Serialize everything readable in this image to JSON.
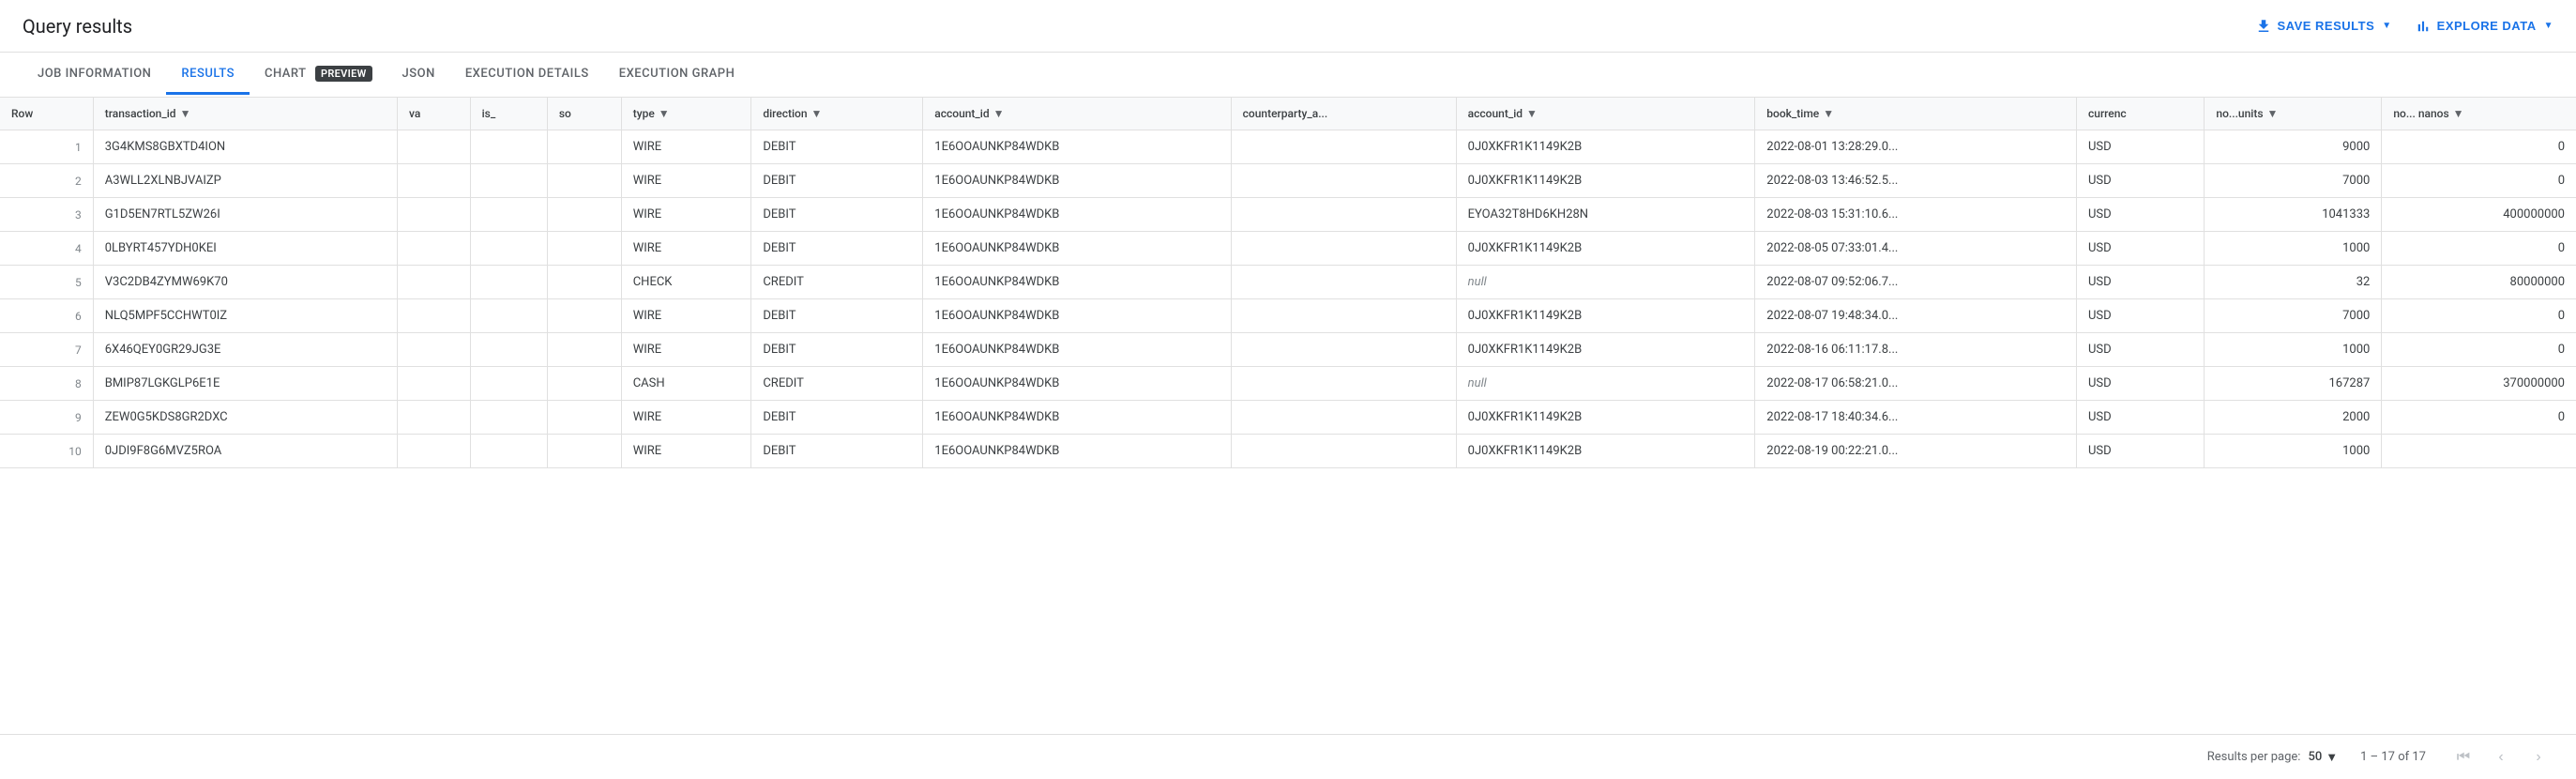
{
  "header": {
    "title": "Query results",
    "actions": {
      "save_results": "SAVE RESULTS",
      "explore_data": "EXPLORE DATA"
    }
  },
  "tabs": [
    {
      "id": "job-info",
      "label": "JOB INFORMATION",
      "active": false
    },
    {
      "id": "results",
      "label": "RESULTS",
      "active": true
    },
    {
      "id": "chart",
      "label": "CHART",
      "active": false,
      "badge": "PREVIEW"
    },
    {
      "id": "json",
      "label": "JSON",
      "active": false
    },
    {
      "id": "execution-details",
      "label": "EXECUTION DETAILS",
      "active": false
    },
    {
      "id": "execution-graph",
      "label": "EXECUTION GRAPH",
      "active": false
    }
  ],
  "table": {
    "columns": [
      {
        "id": "row",
        "label": "Row",
        "sortable": false
      },
      {
        "id": "transaction_id",
        "label": "transaction_id",
        "sortable": true
      },
      {
        "id": "va",
        "label": "va",
        "sortable": false
      },
      {
        "id": "is_",
        "label": "is_",
        "sortable": false
      },
      {
        "id": "so",
        "label": "so",
        "sortable": false
      },
      {
        "id": "type",
        "label": "type",
        "sortable": true
      },
      {
        "id": "direction",
        "label": "direction",
        "sortable": true
      },
      {
        "id": "account_id",
        "label": "account_id",
        "sortable": true
      },
      {
        "id": "counterparty_a",
        "label": "counterparty_a...",
        "sortable": false
      },
      {
        "id": "account_id2",
        "label": "account_id",
        "sortable": true
      },
      {
        "id": "book_time",
        "label": "book_time",
        "sortable": true
      },
      {
        "id": "currency",
        "label": "currenc",
        "sortable": false
      },
      {
        "id": "no_units",
        "label": "no...units",
        "sortable": true
      },
      {
        "id": "no_nanos",
        "label": "no... nanos",
        "sortable": true
      }
    ],
    "rows": [
      {
        "row": 1,
        "transaction_id": "3G4KMS8GBXTD4ION",
        "va": "",
        "is_": "",
        "so": "",
        "type": "WIRE",
        "direction": "DEBIT",
        "account_id": "1E6OOAUNKP84WDKB",
        "counterparty_a": "",
        "account_id2": "0J0XKFR1K1149K2B",
        "book_time": "2022-08-01 13:28:29.0...",
        "currency": "USD",
        "no_units": "9000",
        "no_nanos": "0"
      },
      {
        "row": 2,
        "transaction_id": "A3WLL2XLNBJVAIZP",
        "va": "",
        "is_": "",
        "so": "",
        "type": "WIRE",
        "direction": "DEBIT",
        "account_id": "1E6OOAUNKP84WDKB",
        "counterparty_a": "",
        "account_id2": "0J0XKFR1K1149K2B",
        "book_time": "2022-08-03 13:46:52.5...",
        "currency": "USD",
        "no_units": "7000",
        "no_nanos": "0"
      },
      {
        "row": 3,
        "transaction_id": "G1D5EN7RTL5ZW26I",
        "va": "",
        "is_": "",
        "so": "",
        "type": "WIRE",
        "direction": "DEBIT",
        "account_id": "1E6OOAUNKP84WDKB",
        "counterparty_a": "",
        "account_id2": "EYOA32T8HD6KH28N",
        "book_time": "2022-08-03 15:31:10.6...",
        "currency": "USD",
        "no_units": "1041333",
        "no_nanos": "400000000"
      },
      {
        "row": 4,
        "transaction_id": "0LBYRT457YDH0KEI",
        "va": "",
        "is_": "",
        "so": "",
        "type": "WIRE",
        "direction": "DEBIT",
        "account_id": "1E6OOAUNKP84WDKB",
        "counterparty_a": "",
        "account_id2": "0J0XKFR1K1149K2B",
        "book_time": "2022-08-05 07:33:01.4...",
        "currency": "USD",
        "no_units": "1000",
        "no_nanos": "0"
      },
      {
        "row": 5,
        "transaction_id": "V3C2DB4ZYMW69K70",
        "va": "",
        "is_": "",
        "so": "",
        "type": "CHECK",
        "direction": "CREDIT",
        "account_id": "1E6OOAUNKP84WDKB",
        "counterparty_a": "",
        "account_id2": null,
        "book_time": "2022-08-07 09:52:06.7...",
        "currency": "USD",
        "no_units": "32",
        "no_nanos": "80000000"
      },
      {
        "row": 6,
        "transaction_id": "NLQ5MPF5CCHWT0IZ",
        "va": "",
        "is_": "",
        "so": "",
        "type": "WIRE",
        "direction": "DEBIT",
        "account_id": "1E6OOAUNKP84WDKB",
        "counterparty_a": "",
        "account_id2": "0J0XKFR1K1149K2B",
        "book_time": "2022-08-07 19:48:34.0...",
        "currency": "USD",
        "no_units": "7000",
        "no_nanos": "0"
      },
      {
        "row": 7,
        "transaction_id": "6X46QEY0GR29JG3E",
        "va": "",
        "is_": "",
        "so": "",
        "type": "WIRE",
        "direction": "DEBIT",
        "account_id": "1E6OOAUNKP84WDKB",
        "counterparty_a": "",
        "account_id2": "0J0XKFR1K1149K2B",
        "book_time": "2022-08-16 06:11:17.8...",
        "currency": "USD",
        "no_units": "1000",
        "no_nanos": "0"
      },
      {
        "row": 8,
        "transaction_id": "BMIP87LGKGLP6E1E",
        "va": "",
        "is_": "",
        "so": "",
        "type": "CASH",
        "direction": "CREDIT",
        "account_id": "1E6OOAUNKP84WDKB",
        "counterparty_a": "",
        "account_id2": null,
        "book_time": "2022-08-17 06:58:21.0...",
        "currency": "USD",
        "no_units": "167287",
        "no_nanos": "370000000"
      },
      {
        "row": 9,
        "transaction_id": "ZEW0G5KDS8GR2DXC",
        "va": "",
        "is_": "",
        "so": "",
        "type": "WIRE",
        "direction": "DEBIT",
        "account_id": "1E6OOAUNKP84WDKB",
        "counterparty_a": "",
        "account_id2": "0J0XKFR1K1149K2B",
        "book_time": "2022-08-17 18:40:34.6...",
        "currency": "USD",
        "no_units": "2000",
        "no_nanos": "0"
      },
      {
        "row": 10,
        "transaction_id": "0JDI9F8G6MVZ5ROA",
        "va": "",
        "is_": "",
        "so": "",
        "type": "WIRE",
        "direction": "DEBIT",
        "account_id": "1E6OOAUNKP84WDKB",
        "counterparty_a": "",
        "account_id2": "0J0XKFR1K1149K2B",
        "book_time": "2022-08-19 00:22:21.0...",
        "currency": "USD",
        "no_units": "1000",
        "no_nanos": ""
      }
    ]
  },
  "footer": {
    "results_per_page_label": "Results per page:",
    "per_page_value": "50",
    "pagination_info": "1 – 17 of 17"
  }
}
